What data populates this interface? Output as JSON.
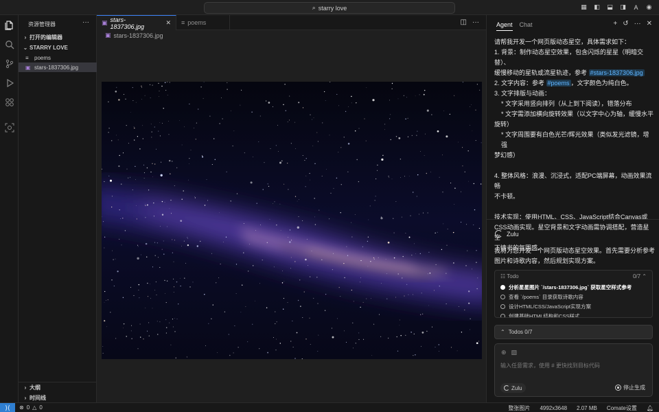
{
  "titlebar": {
    "search": "starry love"
  },
  "sidebar": {
    "title": "资源管理器",
    "open_editors": "打开的编辑器",
    "folder": "STARRY LOVE",
    "files": [
      {
        "name": "poems",
        "type": "text"
      },
      {
        "name": "stars-1837306.jpg",
        "type": "image",
        "selected": true
      }
    ],
    "outline": "大纲",
    "timeline": "时间线"
  },
  "editor": {
    "tabs": [
      {
        "label": "stars-1837306.jpg",
        "active": true
      },
      {
        "label": "poems",
        "active": false
      }
    ],
    "breadcrumb": "stars-1837306.jpg"
  },
  "panel": {
    "tabs": [
      "Agent",
      "Chat"
    ],
    "user_message": {
      "intro": "请帮我开发一个网页版动态星空，具体需求如下：",
      "l1a": "1. 背景：制作动态星空效果，包含闪烁的星星（明暗交替）、",
      "l1b": "缓慢移动的星轨或流星轨迹，参考",
      "tag1": "#stars-1837306.jpg",
      "l2a": "2. 文字内容：参考",
      "tag2": "#poems",
      "l2b": "，文字颜色为纯白色。",
      "l3": "3. 文字排版与动画：",
      "l3a": "* 文字采用竖向排列（从上到下阅读），错落分布",
      "l3b1": "* 文字需添加横向旋转效果（以文字中心为轴，缓慢水平",
      "l3b2": "旋转）",
      "l3c1": "* 文字周围要有白色光芒/辉光效果（类似发光滤镜，增强",
      "l3c2": "梦幻感）",
      "l4a": "4. 整体风格：浪漫、沉浸式，适配PC端屏幕，动画效果流畅",
      "l4b": "不卡顿。",
      "tech1": "技术实现：使用HTML、CSS、JavaScript结合Canvas或",
      "tech2": "CSS动画实现。星空背景和文字动画需协调搭配，营造星空",
      "tech3": "下情书的氛围感。"
    },
    "assistant_name": "Zulu",
    "assistant_reply": {
      "line1": "我将为您开发一个网页版动态星空效果。首先需要分析参考",
      "line2": "图片和诗歌内容，然后规划实现方案。"
    },
    "todo": {
      "title": "Todo",
      "count": "0/7",
      "items": [
        {
          "text": "分析星星图片 `/stars-1837306.jpg` 获取星空样式参考",
          "current": true
        },
        {
          "text": "查看 `/poems` 目录获取诗歌内容",
          "current": false
        },
        {
          "text": "设计HTML/CSS/JavaScript实现方案",
          "current": false
        },
        {
          "text": "创建基础HTML结构和CSS样式",
          "current": false
        }
      ]
    },
    "todos_bar": "Todos 0/7",
    "input": {
      "placeholder": "输入任意需求，使用 # 更快找到目标代码",
      "model": "Zulu",
      "stop": "停止生成"
    }
  },
  "statusbar": {
    "errors": "0",
    "warnings": "0",
    "view": "整张图片",
    "dimensions": "4992x3648",
    "size": "2.07 MB",
    "settings": "Comate设置"
  }
}
